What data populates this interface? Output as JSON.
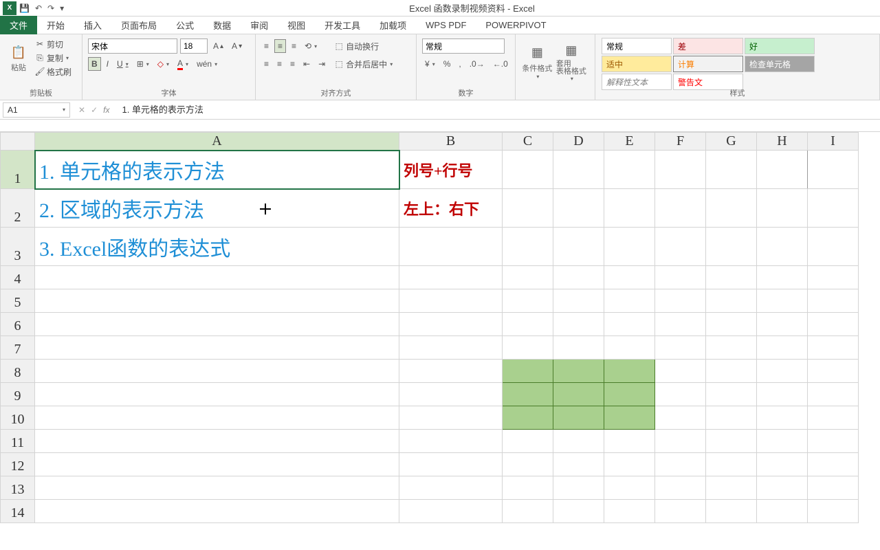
{
  "app": {
    "title": "Excel 函数录制视频资料 - Excel"
  },
  "qat": {
    "save_icon": "💾",
    "undo_icon": "↶",
    "redo_icon": "↷",
    "customize_icon": "▾"
  },
  "tabs": {
    "file": "文件",
    "home": "开始",
    "insert": "插入",
    "layout": "页面布局",
    "formulas": "公式",
    "data": "数据",
    "review": "审阅",
    "view": "视图",
    "dev": "开发工具",
    "addins": "加载项",
    "wps": "WPS PDF",
    "powerpivot": "POWERPIVOT"
  },
  "ribbon": {
    "clipboard": {
      "paste": "粘贴",
      "cut": "剪切",
      "copy": "复制",
      "painter": "格式刷",
      "label": "剪贴板"
    },
    "font": {
      "name": "宋体",
      "size": "18",
      "label": "字体"
    },
    "align": {
      "wrap": "自动换行",
      "merge": "合并后居中",
      "label": "对齐方式"
    },
    "number": {
      "format": "常规",
      "label": "数字"
    },
    "styles": {
      "cond": "条件格式",
      "table": "套用\n表格格式",
      "normal": "常规",
      "bad": "差",
      "good": "好",
      "neutral": "适中",
      "calc": "计算",
      "check": "检查单元格",
      "explain": "解释性文本",
      "warn": "警告文",
      "label": "样式"
    }
  },
  "namebox": "A1",
  "formula": "1. 单元格的表示方法",
  "columns": [
    "A",
    "B",
    "C",
    "D",
    "E",
    "F",
    "G",
    "H",
    "I"
  ],
  "rows": [
    "1",
    "2",
    "3",
    "4",
    "5",
    "6",
    "7",
    "8",
    "9",
    "10",
    "11",
    "12",
    "13",
    "14"
  ],
  "cells": {
    "A1": "1. 单元格的表示方法",
    "A2": "2. 区域的表示方法",
    "A3": "3. Excel函数的表达式",
    "B1": "列号+行号",
    "B2": "左上：右下"
  },
  "col_widths": {
    "A": 530,
    "B": 150,
    "C": 74,
    "D": 74,
    "E": 74,
    "F": 74,
    "G": 74,
    "H": 74,
    "I": 74
  }
}
